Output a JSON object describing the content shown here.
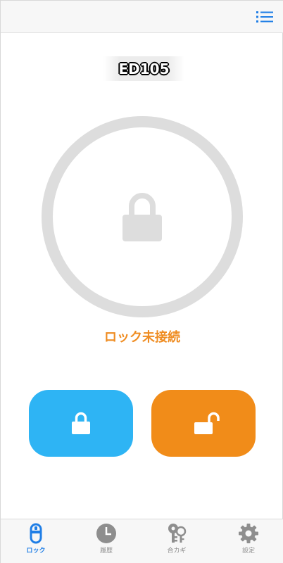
{
  "header": {
    "menu_icon": "list-menu-icon",
    "accent_color": "#1f7ee6"
  },
  "device": {
    "name": "ED105"
  },
  "lock_display": {
    "icon": "padlock-locked-icon",
    "ring_color": "#dddddd"
  },
  "status": {
    "text": "ロック未接続",
    "color": "#ef8c21"
  },
  "actions": {
    "lock_button": {
      "icon": "padlock-locked-icon",
      "color": "#2eb4f4"
    },
    "unlock_button": {
      "icon": "padlock-unlocked-icon",
      "color": "#f18c19"
    }
  },
  "tabs": [
    {
      "label": "ロック",
      "icon": "lock-device-icon",
      "active": true
    },
    {
      "label": "履歴",
      "icon": "clock-icon",
      "active": false
    },
    {
      "label": "合カギ",
      "icon": "keys-icon",
      "active": false
    },
    {
      "label": "設定",
      "icon": "gear-icon",
      "active": false
    }
  ]
}
